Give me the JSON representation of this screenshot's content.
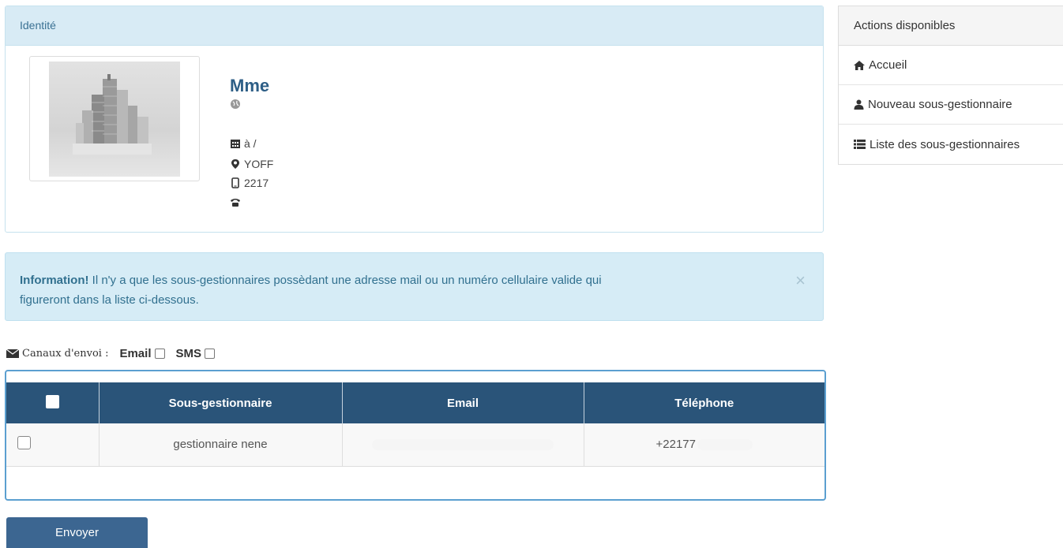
{
  "identity": {
    "heading": "Identité",
    "civility": "Mme",
    "birth": "à /",
    "address": "YOFF",
    "mobile": "2217",
    "phone": ""
  },
  "sidebar": {
    "title": "Actions disponibles",
    "items": [
      {
        "label": "Accueil",
        "icon": "home-icon"
      },
      {
        "label": "Nouveau sous-gestionnaire",
        "icon": "user-icon"
      },
      {
        "label": "Liste des sous-gestionnaires",
        "icon": "list-icon"
      }
    ]
  },
  "alert": {
    "title": "Information!",
    "text": " Il n'y a que les sous-gestionnaires possèdant une adresse mail ou un numéro cellulaire valide qui",
    "text2": "figureront dans la liste ci-dessous.",
    "close": "×"
  },
  "channels": {
    "label": "Canaux d'envoi :",
    "email": "Email",
    "sms": "SMS"
  },
  "table": {
    "headers": [
      "Sous-gestionnaire",
      "Email",
      "Téléphone"
    ],
    "rows": [
      {
        "name": "gestionnaire nene",
        "email": "",
        "phone": "+22177"
      }
    ]
  },
  "send_button": "Envoyer",
  "colors": {
    "header_bg": "#2a5479",
    "alert_bg": "#d6ecf6",
    "panel_heading_bg": "#d8ebf5",
    "button_bg": "#3c6691"
  }
}
